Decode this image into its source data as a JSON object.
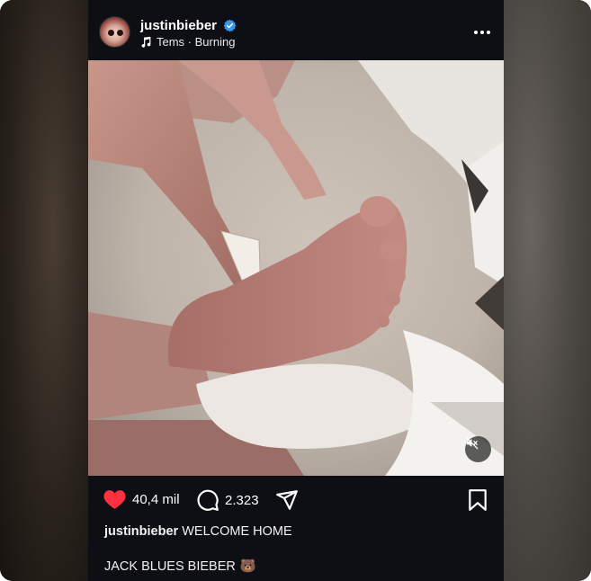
{
  "post": {
    "username": "justinbieber",
    "music": "Tems · Burning",
    "likes": "40,4 mil",
    "comments": "2.323",
    "caption_user": "justinbieber",
    "caption_text": "WELCOME HOME",
    "caption_line2": "JACK BLUES BIEBER",
    "caption_emoji": "🐻"
  },
  "icons": {
    "verified": "verified-badge-icon",
    "music": "music-note-icon",
    "more": "more-options-icon",
    "mute": "muted-speaker-icon",
    "like": "heart-icon",
    "comment": "comment-icon",
    "share": "send-icon",
    "save": "bookmark-icon"
  },
  "colors": {
    "background": "#0d0f14",
    "like": "#ff3040",
    "verified": "#3897f0",
    "text": "#ffffff"
  }
}
